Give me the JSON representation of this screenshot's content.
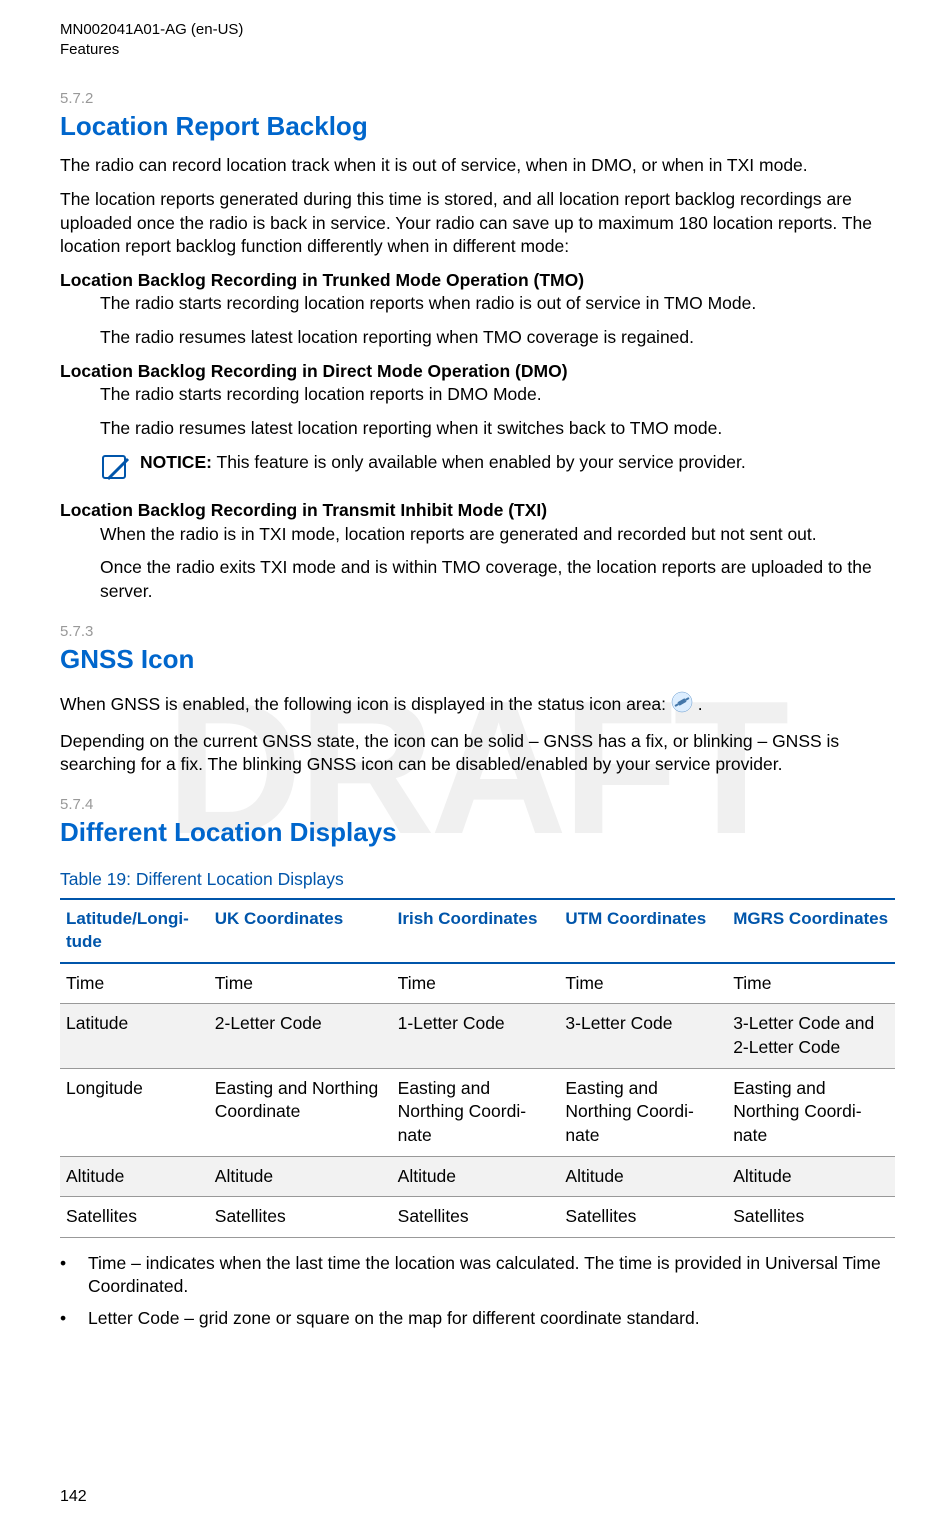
{
  "header": {
    "doc_id": "MN002041A01-AG (en-US)",
    "chapter": "Features"
  },
  "watermark": "DRAFT",
  "section_572": {
    "num": "5.7.2",
    "title": "Location Report Backlog",
    "p1": "The radio can record location track when it is out of service, when in DMO, or when in TXI mode.",
    "p2": "The location reports generated during this time is stored, and all location report backlog recordings are uploaded once the radio is back in service. Your radio can save up to maximum 180 location reports. The location report backlog function differently when in different mode:",
    "tmo_heading": "Location Backlog Recording in Trunked Mode Operation (TMO)",
    "tmo_p1": "The radio starts recording location reports when radio is out of service in TMO Mode.",
    "tmo_p2": "The radio resumes latest location reporting when TMO coverage is regained.",
    "dmo_heading": "Location Backlog Recording in Direct Mode Operation (DMO)",
    "dmo_p1": "The radio starts recording location reports in DMO Mode.",
    "dmo_p2": "The radio resumes latest location reporting when it switches back to TMO mode.",
    "notice_label": "NOTICE:",
    "notice_text": " This feature is only available when enabled by your service provider.",
    "txi_heading": "Location Backlog Recording in Transmit Inhibit Mode (TXI)",
    "txi_p1": "When the radio is in TXI mode, location reports are generated and recorded but not sent out.",
    "txi_p2": "Once the radio exits TXI mode and is within TMO coverage, the location reports are uploaded to the server."
  },
  "section_573": {
    "num": "5.7.3",
    "title": "GNSS Icon",
    "p1_pre": "When GNSS is enabled, the following icon is displayed in the status icon area: ",
    "p1_post": " .",
    "p2": "Depending on the current GNSS state, the icon can be solid – GNSS has a fix, or blinking – GNSS is searching for a fix. The blinking GNSS icon can be disabled/enabled by your service provider."
  },
  "section_574": {
    "num": "5.7.4",
    "title": "Different Location Displays",
    "table_title": "Table 19: Different Location Displays",
    "headers": [
      "Latitude/Longi­tude",
      "UK Coordinates",
      "Irish Coordi­nates",
      "UTM Coordi­nates",
      "MGRS Coordi­nates"
    ],
    "rows": [
      [
        "Time",
        "Time",
        "Time",
        "Time",
        "Time"
      ],
      [
        "Latitude",
        "2-Letter Code",
        "1-Letter Code",
        "3-Letter Code",
        "3-Letter Code and 2-Letter Code"
      ],
      [
        "Longitude",
        "Easting and Northing Coordi­nate",
        "Easting and Northing Coordi­nate",
        "Easting and Northing Coordi­nate",
        "Easting and Northing Coordi­nate"
      ],
      [
        "Altitude",
        "Altitude",
        "Altitude",
        "Altitude",
        "Altitude"
      ],
      [
        "Satellites",
        "Satellites",
        "Satellites",
        "Satellites",
        "Satellites"
      ]
    ],
    "bullets": [
      "Time – indicates when the last time the location was calculated. The time is provided in Universal Time Coordinated.",
      "Letter Code – grid zone or square on the map for different coordinate standard."
    ]
  },
  "page_number": "142"
}
